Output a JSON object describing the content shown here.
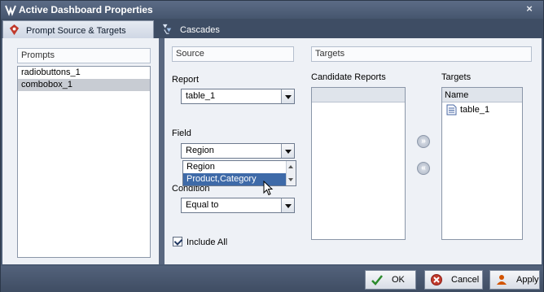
{
  "window": {
    "title": "Active Dashboard Properties",
    "close_glyph": "×"
  },
  "tabs": [
    {
      "label": "Prompt Source & Targets",
      "icon": "prompt-targets-icon"
    },
    {
      "label": "Cascades",
      "icon": "cascades-icon"
    }
  ],
  "prompts": {
    "header": "Prompts",
    "items": [
      "radiobuttons_1",
      "combobox_1"
    ],
    "selected_index": 1
  },
  "source": {
    "header": "Source",
    "report_label": "Report",
    "report_value": "table_1",
    "field_label": "Field",
    "field_value": "Region",
    "field_options": [
      "Region",
      "Product,Category"
    ],
    "field_hover_option": "Product,Category",
    "condition_label": "Condition",
    "condition_value": "Equal to",
    "include_all_label": "Include All",
    "include_all_checked": true
  },
  "targets": {
    "header": "Targets",
    "candidate_label": "Candidate Reports",
    "targets_label": "Targets",
    "targets_column": "Name",
    "target_items": [
      "table_1"
    ]
  },
  "footer": {
    "ok_label": "OK",
    "cancel_label": "Cancel",
    "apply_label": "Apply"
  },
  "colors": {
    "title_bar": "#4a5a72",
    "selection": "#3e6aa8",
    "panel_bg": "#eef1f6"
  }
}
